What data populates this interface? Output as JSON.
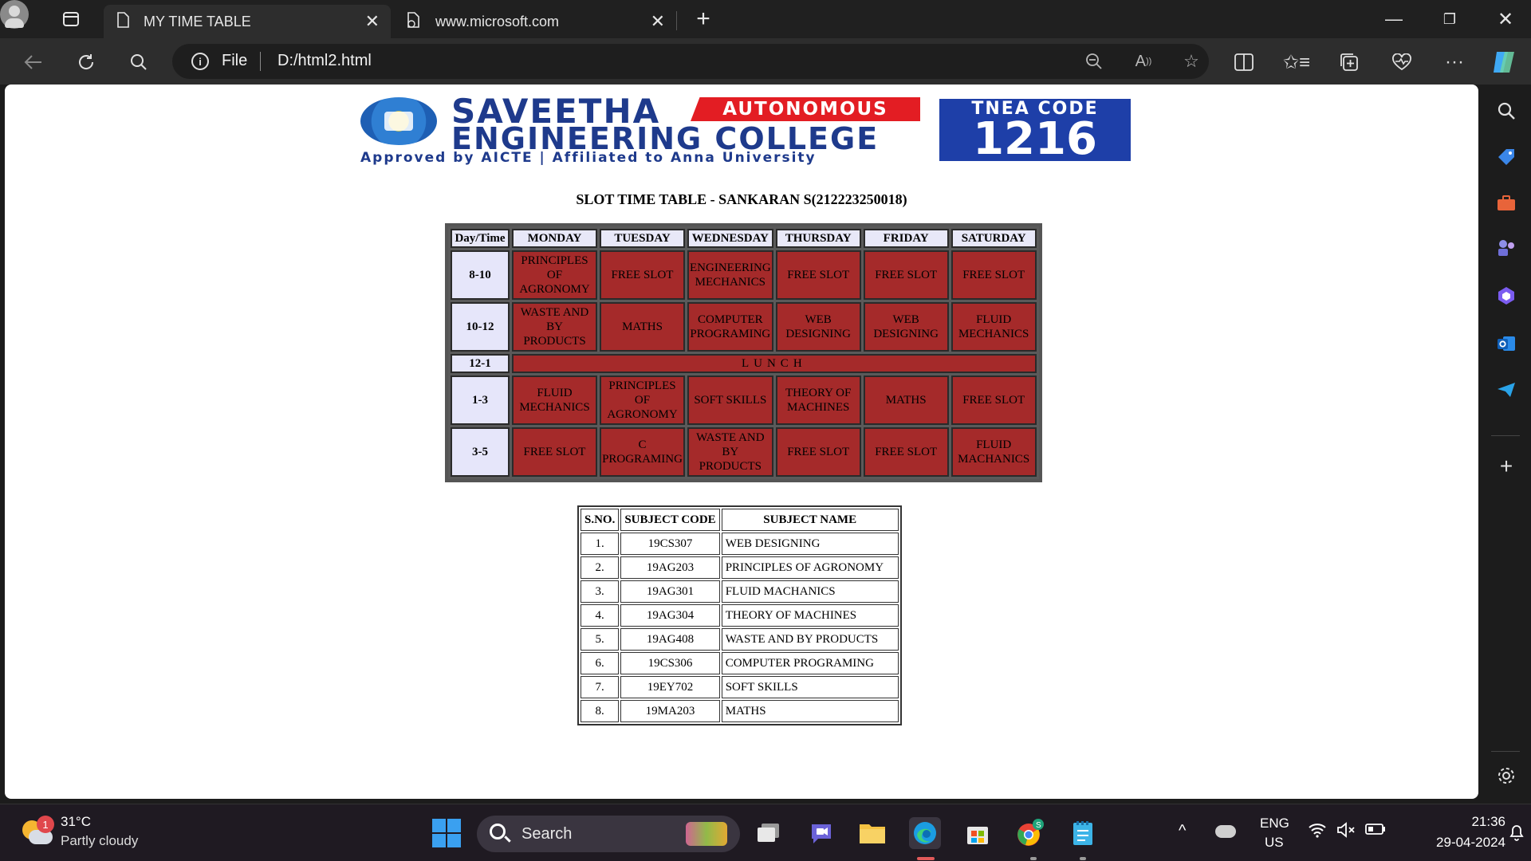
{
  "browser": {
    "tabs": [
      {
        "title": "MY TIME TABLE"
      },
      {
        "title": "www.microsoft.com"
      }
    ],
    "address": {
      "scheme": "File",
      "url": "D:/html2.html"
    },
    "colors": {
      "titlebar": "#202020",
      "toolbar": "#2d2d2d",
      "address_bg": "#1e1e1e"
    }
  },
  "banner": {
    "brand_line1": "SAVEETHA",
    "autonomous": "AUTONOMOUS",
    "brand_line2": "ENGINEERING COLLEGE",
    "subline": "Approved by AICTE  |  Affiliated to Anna University",
    "tnea_label": "TNEA CODE",
    "tnea_code": "1216",
    "colors": {
      "brand": "#1e3a8c",
      "accent_red": "#e31d23",
      "tnea_bg": "#1e3fa8"
    }
  },
  "page": {
    "heading": "SLOT TIME TABLE - SANKARAN S(212223250018)"
  },
  "timetable": {
    "headers": [
      "Day/Time",
      "MONDAY",
      "TUESDAY",
      "WEDNESDAY",
      "THURSDAY",
      "FRIDAY",
      "SATURDAY"
    ],
    "rows": [
      {
        "time": "8-10",
        "cells": [
          "PRINCIPLES OF AGRONOMY",
          "FREE SLOT",
          "ENGINEERING MECHANICS",
          "FREE SLOT",
          "FREE SLOT",
          "FREE SLOT"
        ]
      },
      {
        "time": "10-12",
        "cells": [
          "WASTE AND BY PRODUCTS",
          "MATHS",
          "COMPUTER PROGRAMING",
          "WEB DESIGNING",
          "WEB DESIGNING",
          "FLUID MECHANICS"
        ]
      },
      {
        "time": "12-1",
        "lunch": "LUNCH"
      },
      {
        "time": "1-3",
        "cells": [
          "FLUID MECHANICS",
          "PRINCIPLES OF AGRONOMY",
          "SOFT SKILLS",
          "THEORY OF MACHINES",
          "MATHS",
          "FREE SLOT"
        ]
      },
      {
        "time": "3-5",
        "cells": [
          "FREE SLOT",
          "C PROGRAMING",
          "WASTE AND BY PRODUCTS",
          "FREE SLOT",
          "FREE SLOT",
          "FLUID MACHANICS"
        ]
      }
    ],
    "colors": {
      "slot_bg": "#a52a2a",
      "header_bg": "#e8e8f8",
      "time_bg": "#e6e6fa"
    }
  },
  "subjects": {
    "headers": [
      "S.NO.",
      "SUBJECT CODE",
      "SUBJECT NAME"
    ],
    "rows": [
      [
        "1.",
        "19CS307",
        "WEB DESIGNING"
      ],
      [
        "2.",
        "19AG203",
        "PRINCIPLES OF AGRONOMY"
      ],
      [
        "3.",
        "19AG301",
        "FLUID MACHANICS"
      ],
      [
        "4.",
        "19AG304",
        "THEORY OF MACHINES"
      ],
      [
        "5.",
        "19AG408",
        "WASTE AND BY PRODUCTS"
      ],
      [
        "6.",
        "19CS306",
        "COMPUTER PROGRAMING"
      ],
      [
        "7.",
        "19EY702",
        "SOFT SKILLS"
      ],
      [
        "8.",
        "19MA203",
        "MATHS"
      ]
    ]
  },
  "taskbar": {
    "weather": {
      "temp": "31°C",
      "desc": "Partly cloudy",
      "badge": "1"
    },
    "search_placeholder": "Search",
    "language": {
      "line1": "ENG",
      "line2": "US"
    },
    "clock": {
      "time": "21:36",
      "date": "29-04-2024"
    }
  }
}
